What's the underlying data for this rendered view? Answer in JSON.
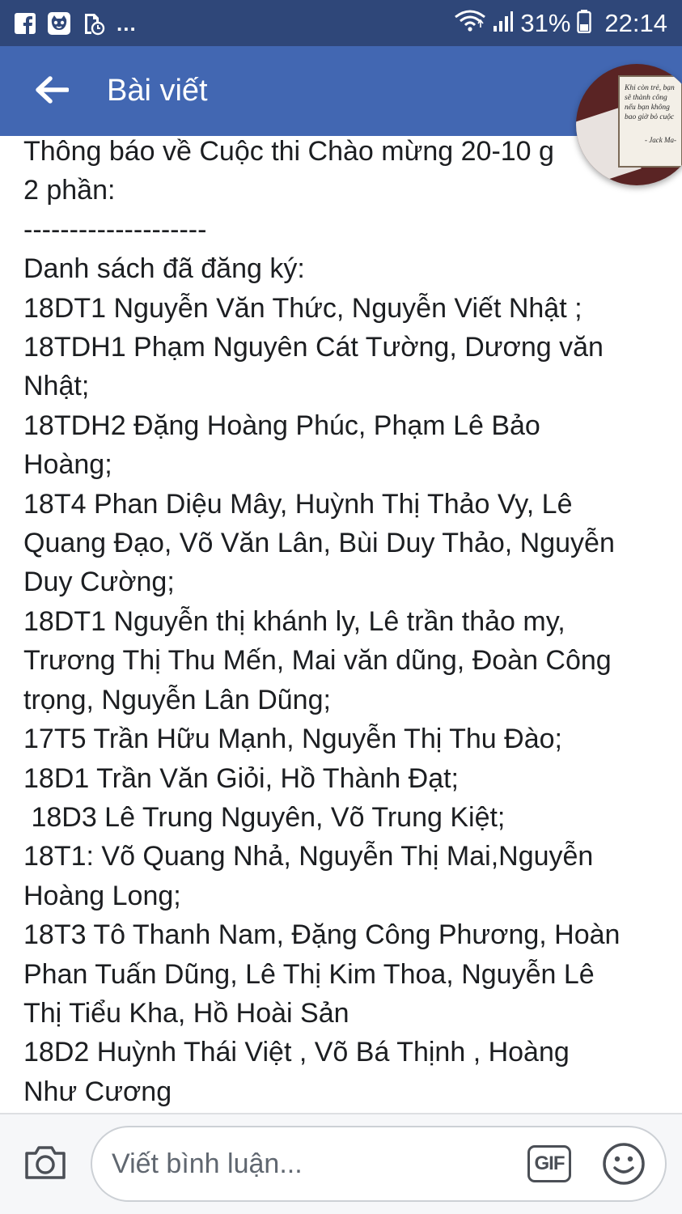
{
  "status_bar": {
    "notification_icons": [
      "facebook-icon",
      "cat-face-icon",
      "document-clock-icon"
    ],
    "more_indicator": "...",
    "battery_percent": "31%",
    "time": "22:14",
    "status_icons": [
      "wifi-icon",
      "signal-bars-icon",
      "battery-icon"
    ]
  },
  "header": {
    "back_icon": "arrow-left-icon",
    "title": "Bài viết",
    "background_color": "#4267b2"
  },
  "chat_head": {
    "quote_lines": [
      "Khi còn trẻ, bạn",
      "sẽ thành công",
      "nếu bạn không",
      "bao giờ bỏ cuộc"
    ],
    "author": "- Jack Ma-"
  },
  "post": {
    "lines": [
      "Thông báo về Cuộc thi Chào mừng 20-10 g",
      "2 phần:",
      "--------------------",
      "Danh sách đã đăng ký:",
      "18DT1 Nguyễn Văn Thức, Nguyễn Viết Nhật ;",
      "18TDH1 Phạm Nguyên Cát Tường, Dương văn",
      "Nhật;",
      "18TDH2 Đặng Hoàng Phúc, Phạm Lê Bảo",
      "Hoàng;",
      "18T4 Phan Diệu Mây, Huỳnh Thị Thảo Vy, Lê",
      "Quang Đạo, Võ Văn Lân, Bùi Duy Thảo, Nguyễn",
      "Duy Cường;",
      "18DT1 Nguyễn thị khánh ly, Lê trần thảo my,",
      "Trương Thị Thu Mến, Mai văn dũng, Đoàn Công",
      "trọng, Nguyễn Lân Dũng;",
      "17T5 Trần Hữu Mạnh, Nguyễn Thị Thu Đào;",
      "18D1 Trần Văn Giỏi, Hồ Thành Đạt;",
      " 18D3 Lê Trung Nguyên, Võ Trung Kiệt;",
      "18T1: Võ Quang Nhả, Nguyễn Thị Mai,Nguyễn",
      "Hoàng Long;",
      "18T3 Tô Thanh Nam, Đặng Công Phương, Hoàn",
      "Phan Tuấn Dũng, Lê Thị Kim Thoa, Nguyễn Lê",
      "Thị Tiểu Kha, Hồ Hoài Sản",
      "18D2 Huỳnh Thái Việt , Võ Bá Thịnh , Hoàng",
      "Như Cương"
    ]
  },
  "comment_bar": {
    "camera_icon": "camera-icon",
    "placeholder": "Viết bình luận...",
    "gif_label": "GIF",
    "emoji_icon": "smiley-icon"
  }
}
